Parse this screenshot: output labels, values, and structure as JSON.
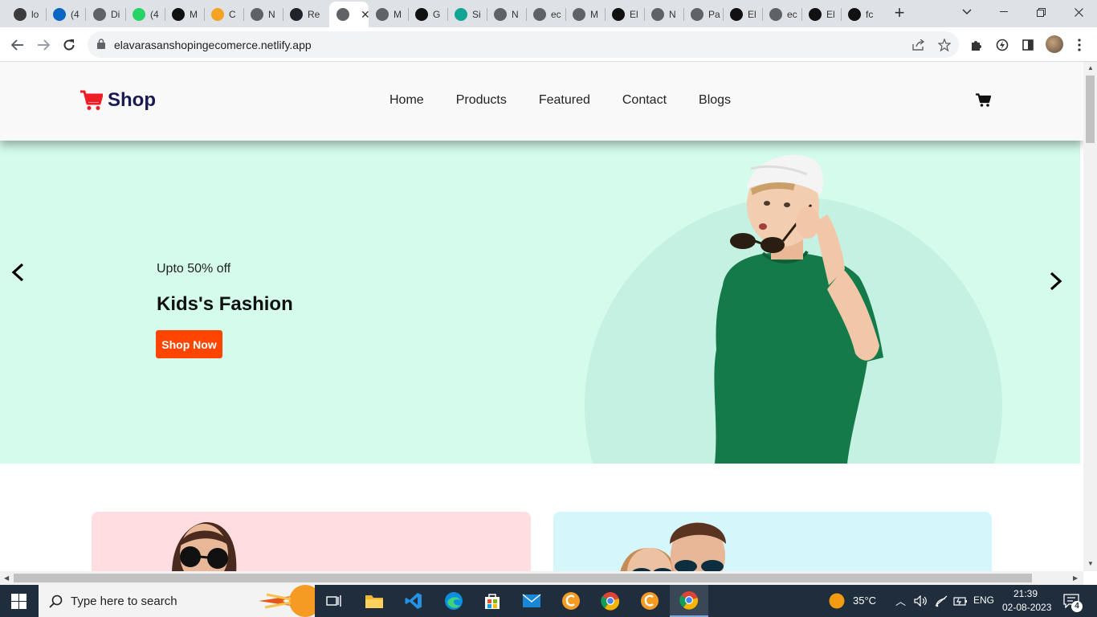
{
  "browser": {
    "tabs": [
      {
        "title": "lo",
        "icon": "react-icon",
        "color": "#3c3c3c"
      },
      {
        "title": "(4",
        "icon": "linkedin-icon",
        "color": "#0a66c2"
      },
      {
        "title": "Di",
        "icon": "globe-icon",
        "color": "#5f6368"
      },
      {
        "title": "(4",
        "icon": "whatsapp-icon",
        "color": "#25d366"
      },
      {
        "title": "M",
        "icon": "triangle-icon",
        "color": "#111111"
      },
      {
        "title": "C",
        "icon": "coin-icon",
        "color": "#f4a323"
      },
      {
        "title": "N",
        "icon": "chrome-icon",
        "color": "#5f6368"
      },
      {
        "title": "Re",
        "icon": "react-icon",
        "color": "#20232a"
      },
      {
        "title": "",
        "icon": "globe-icon",
        "color": "#5f6368"
      },
      {
        "title": "M",
        "icon": "globe-icon",
        "color": "#5f6368"
      },
      {
        "title": "G",
        "icon": "github-icon",
        "color": "#111111"
      },
      {
        "title": "Si",
        "icon": "diamond-icon",
        "color": "#12a594"
      },
      {
        "title": "N",
        "icon": "globe-icon",
        "color": "#5f6368"
      },
      {
        "title": "ec",
        "icon": "globe-icon",
        "color": "#5f6368"
      },
      {
        "title": "M",
        "icon": "globe-icon",
        "color": "#5f6368"
      },
      {
        "title": "El",
        "icon": "github-icon",
        "color": "#111111"
      },
      {
        "title": "N",
        "icon": "globe-icon",
        "color": "#5f6368"
      },
      {
        "title": "Pa",
        "icon": "globe-icon",
        "color": "#5f6368"
      },
      {
        "title": "El",
        "icon": "github-icon",
        "color": "#111111"
      },
      {
        "title": "ec",
        "icon": "globe-icon",
        "color": "#5f6368"
      },
      {
        "title": "El",
        "icon": "github-icon",
        "color": "#111111"
      },
      {
        "title": "fc",
        "icon": "triangle-icon",
        "color": "#111111"
      }
    ],
    "active_tab_index": 8,
    "url": "elavarasanshopingecomerce.netlify.app"
  },
  "site": {
    "brand": "Shop",
    "brand_color": "#1a1a53",
    "cart_color": "#ee1c25",
    "nav": [
      "Home",
      "Products",
      "Featured",
      "Contact",
      "Blogs"
    ]
  },
  "hero": {
    "subtitle": "Upto 50% off",
    "title": "Kids's Fashion",
    "cta": "Shop Now",
    "cta_color": "#ff4500",
    "background": "#d4fbec"
  },
  "taskbar": {
    "search_placeholder": "Type here to search",
    "weather": "35°C",
    "language": "ENG",
    "time": "21:39",
    "date": "02-08-2023",
    "notification_count": "4"
  }
}
